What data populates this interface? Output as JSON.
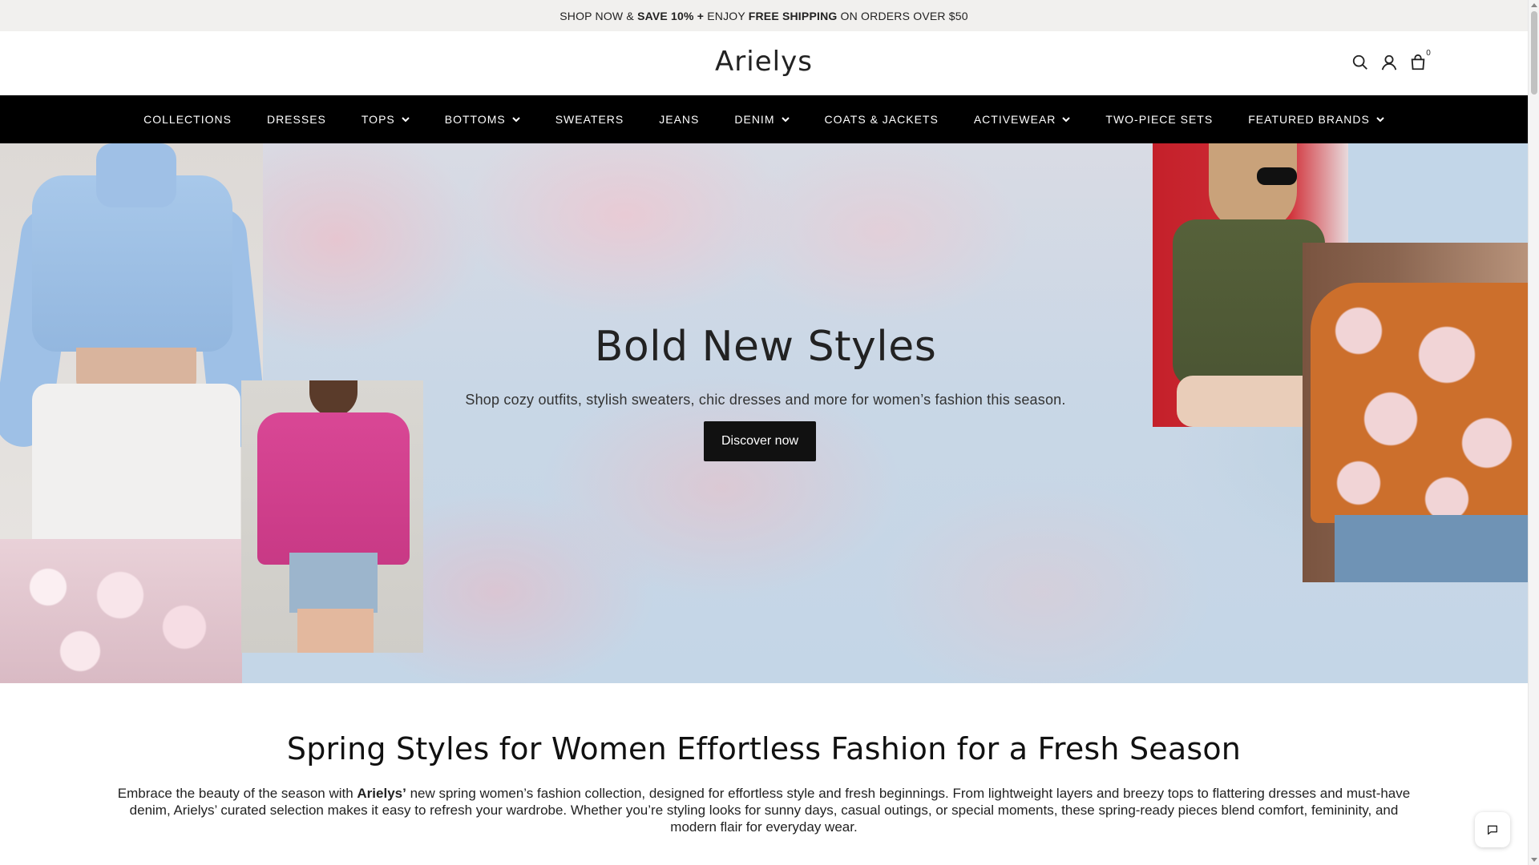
{
  "announcement": {
    "part1": "SHOP NOW & ",
    "part2": "SAVE 10% +",
    "part3": " ENJOY ",
    "part4": "FREE SHIPPING",
    "part5": " ON ORDERS OVER $50"
  },
  "header": {
    "logo": "Arielys",
    "icons": [
      "search-icon",
      "account-icon",
      "cart-icon"
    ],
    "cart_count": "0"
  },
  "nav": {
    "items": [
      {
        "label": "COLLECTIONS",
        "has_dropdown": false
      },
      {
        "label": "DRESSES",
        "has_dropdown": false
      },
      {
        "label": "TOPS",
        "has_dropdown": true
      },
      {
        "label": "BOTTOMS",
        "has_dropdown": true
      },
      {
        "label": "SWEATERS",
        "has_dropdown": false
      },
      {
        "label": "JEANS",
        "has_dropdown": false
      },
      {
        "label": "DENIM",
        "has_dropdown": true
      },
      {
        "label": "COATS & JACKETS",
        "has_dropdown": false
      },
      {
        "label": "ACTIVEWEAR",
        "has_dropdown": true
      },
      {
        "label": "TWO-PIECE SETS",
        "has_dropdown": false
      },
      {
        "label": "FEATURED BRANDS",
        "has_dropdown": true
      }
    ]
  },
  "hero": {
    "title": "Bold New Styles",
    "subtitle": "Shop cozy outfits, stylish sweaters, chic dresses and more for women’s fashion this season.",
    "button_label": "Discover now"
  },
  "section": {
    "title": "Spring Styles for Women Effortless Fashion for a Fresh Season",
    "body_pre": "Embrace the beauty of the season with ",
    "body_bold": "Arielys’",
    "body_post": " new spring women’s fashion collection, designed for effortless style and fresh beginnings. From lightweight layers and breezy tops to flattering dresses and must-have denim, Arielys’ curated selection makes it easy to refresh your wardrobe. Whether you’re styling looks for sunny days, casual outings, or special moments, these spring-ready pieces blend comfort, femininity, and modern flair for everyday wear."
  },
  "colors": {
    "nav_bg": "#000000",
    "announcement_bg": "#f1f0ee",
    "button_bg": "#111111"
  }
}
